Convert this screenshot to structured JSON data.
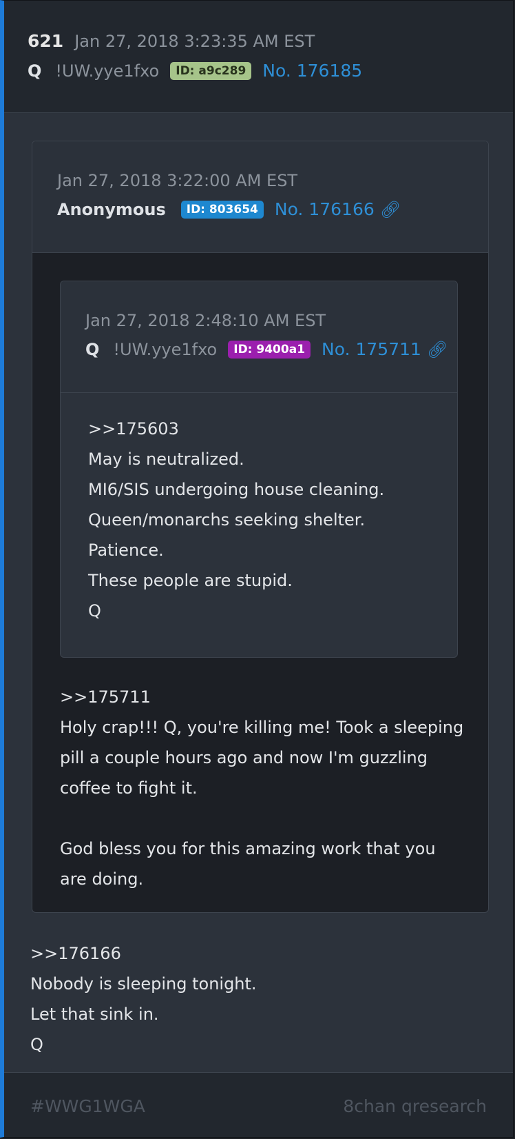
{
  "post": {
    "number": "621",
    "date": "Jan 27, 2018 3:23:35 AM EST",
    "name": "Q",
    "tripcode": "!UW.yye1fxo",
    "id_label": "ID: a9c289",
    "id_color": "#a6c48a",
    "post_no": "No. 176185",
    "body": [
      ">>176166",
      "Nobody is sleeping tonight.",
      "Let that sink in.",
      "Q"
    ]
  },
  "quoted": {
    "date": "Jan 27, 2018 3:22:00 AM EST",
    "name": "Anonymous",
    "id_label": "ID: 803654",
    "id_color": "#1e88d0",
    "post_no": "No. 176166",
    "link_icon": "link-icon",
    "body": [
      ">>175711",
      "Holy crap!!! Q, you're killing me! Took a sleeping",
      "pill a couple hours ago and now I'm guzzling",
      "coffee to fight it.",
      "",
      "God bless you for this amazing work that you",
      "are doing."
    ]
  },
  "nested": {
    "date": "Jan 27, 2018 2:48:10 AM EST",
    "name": "Q",
    "tripcode": "!UW.yye1fxo",
    "id_label": "ID: 9400a1",
    "id_color": "#9b1fae",
    "post_no": "No. 175711",
    "link_icon": "link-icon",
    "body": [
      ">>175603",
      "May is neutralized.",
      "MI6/SIS undergoing house cleaning.",
      "Queen/monarchs seeking shelter.",
      "Patience.",
      "These people are stupid.",
      "Q"
    ]
  },
  "footer": {
    "hashtag": "#WWG1WGA",
    "source": "8chan qresearch"
  },
  "colors": {
    "accent_bar": "#1e7bd8",
    "link": "#2e8fd6"
  }
}
